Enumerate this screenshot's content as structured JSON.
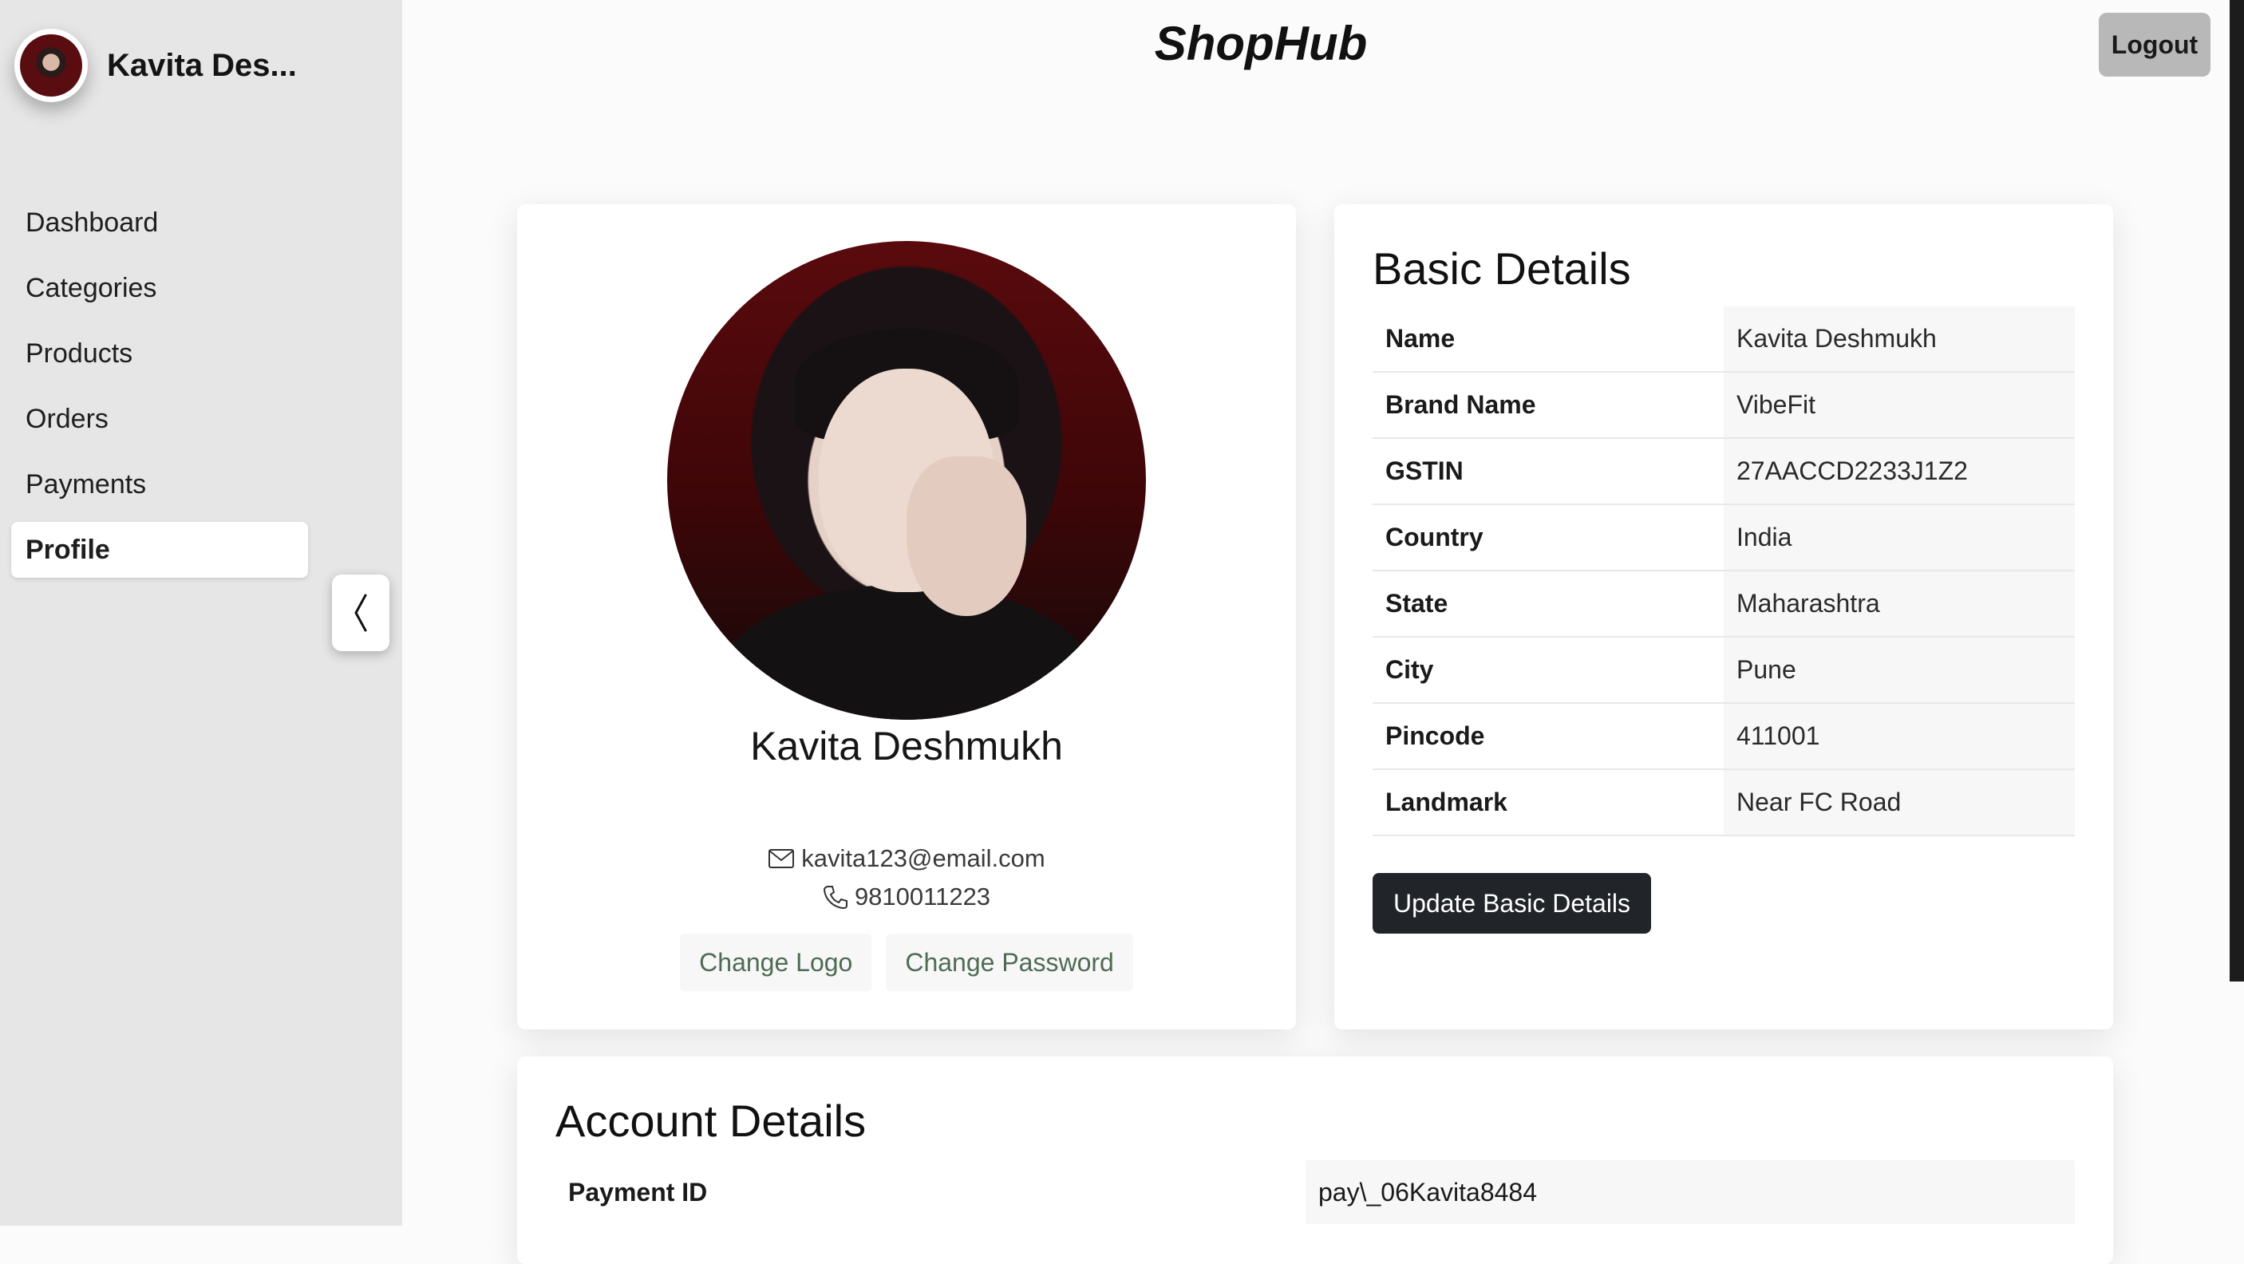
{
  "sidebar": {
    "user_name": "Kavita Des...",
    "nav": [
      "Dashboard",
      "Categories",
      "Products",
      "Orders",
      "Payments",
      "Profile"
    ],
    "active": "Profile",
    "collapse_glyph": "❬"
  },
  "header": {
    "brand": "ShopHub",
    "logout_label": "Logout"
  },
  "profile": {
    "name": "Kavita Deshmukh",
    "email": "kavita123@email.com",
    "phone": "9810011223",
    "change_logo_label": "Change Logo",
    "change_password_label": "Change Password"
  },
  "basic_details": {
    "title": "Basic Details",
    "rows": [
      {
        "label": "Name",
        "value": "Kavita Deshmukh"
      },
      {
        "label": "Brand Name",
        "value": "VibeFit"
      },
      {
        "label": "GSTIN",
        "value": "27AACCD2233J1Z2"
      },
      {
        "label": "Country",
        "value": "India"
      },
      {
        "label": "State",
        "value": "Maharashtra"
      },
      {
        "label": "City",
        "value": "Pune"
      },
      {
        "label": "Pincode",
        "value": "411001"
      },
      {
        "label": "Landmark",
        "value": "Near FC Road"
      }
    ],
    "update_label": "Update Basic Details"
  },
  "account_details": {
    "title": "Account Details",
    "payment_id_label": "Payment ID",
    "payment_id_value": "pay\\_06Kavita8484"
  },
  "icons": {
    "email": "envelope-icon",
    "phone": "phone-icon",
    "collapse": "chevron-left-icon"
  },
  "colors": {
    "sidebar_bg": "#e6e6e6",
    "primary_button": "#212529",
    "link_text": "#4f6b55",
    "logout_bg": "#b8b8b8"
  }
}
